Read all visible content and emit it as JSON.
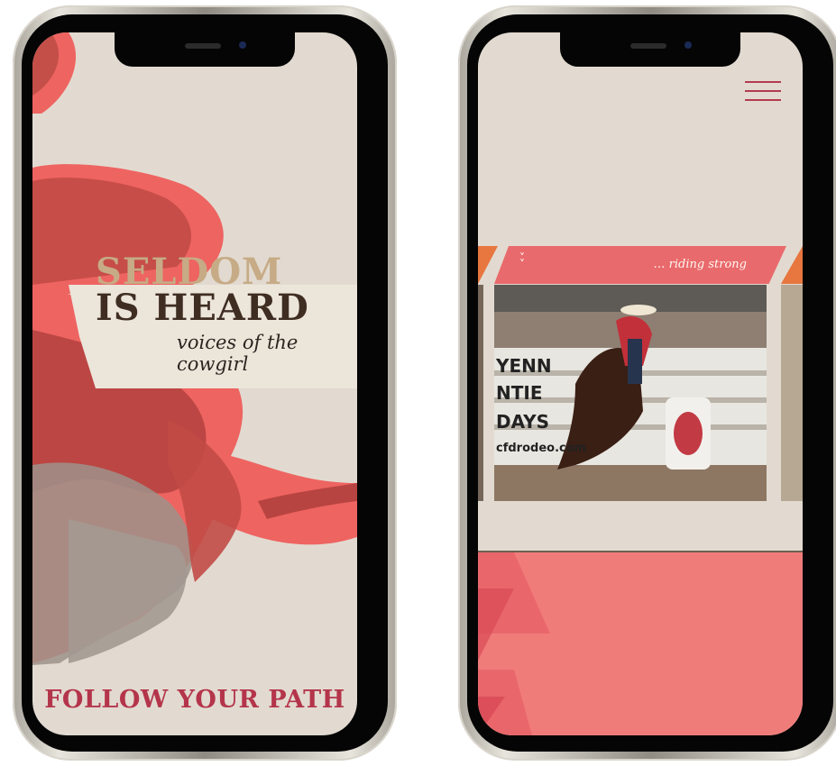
{
  "left_screen": {
    "title_line1": "SELDOM",
    "title_line2": "IS HEARD",
    "subtitle": "voices of the cowgirl",
    "cta": "FOLLOW YOUR PATH"
  },
  "right_screen": {
    "menu_icon": "hamburger-icon",
    "banner_caption": "… riding strong",
    "scroll_icon": "double-chevron-down-icon",
    "photo_sign_text": [
      "YENN",
      "NTIE",
      "DAYS",
      "cfdrodeo.com"
    ]
  },
  "colors": {
    "background": "#e2dad0",
    "accent_red": "#b4354b",
    "coral": "#f07c7a",
    "orange": "#e7763f",
    "title_tan": "#c6ab86",
    "title_brown": "#3f2d22"
  }
}
